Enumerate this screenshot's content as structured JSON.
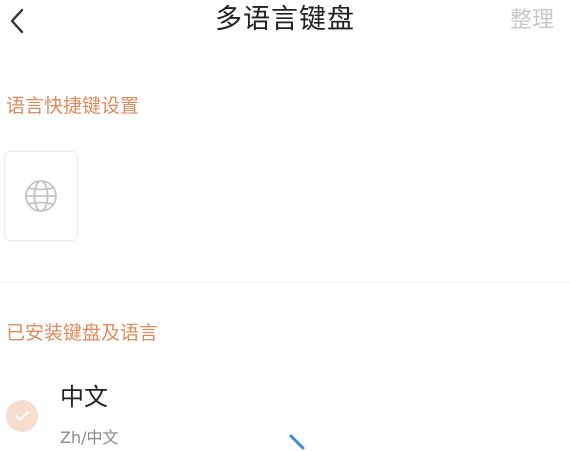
{
  "header": {
    "title": "多语言键盘",
    "organize_label": "整理",
    "back_icon": "chevron-left-icon"
  },
  "shortcut_section": {
    "label": "语言快捷键设置",
    "key_icon": "globe-icon"
  },
  "installed_section": {
    "label": "已安装键盘及语言",
    "items": [
      {
        "name": "中文",
        "code": "Zh/中文",
        "selected": true
      }
    ]
  },
  "colors": {
    "accent": "#e08a5c",
    "check_bg": "#f7ddd0",
    "muted": "#c8c8c8"
  }
}
